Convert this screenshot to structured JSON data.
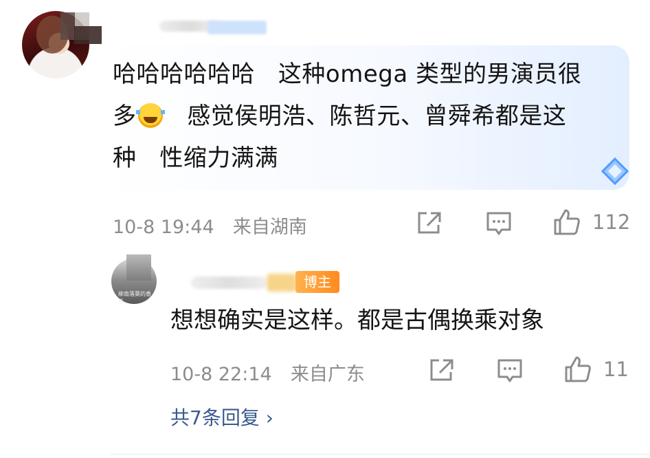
{
  "comment": {
    "text_line1": "哈哈哈哈哈哈   这种omega 类型的男演员很",
    "text_line2_prefix": "多",
    "text_line2_suffix": "   感觉侯明浩、陈哲元、曾舜希都是这",
    "text_line3": "种   性缩力满满",
    "time": "10-8 19:44",
    "location": "来自湖南",
    "like_count": "112"
  },
  "reply": {
    "badge": "博主",
    "text": "想想确实是这样。都是古偶换乘对象",
    "time": "10-8 22:14",
    "location": "来自广东",
    "like_count": "11",
    "avatar_caption": "柳南落葉的香香"
  },
  "more_replies": {
    "label": "共7条回复 ›"
  },
  "colors": {
    "meta_gray": "#8c8c8c",
    "link_blue": "#3a5a8c",
    "badge_orange": "#ff8a1f",
    "bubble_blue": "#e3eeff"
  },
  "icons": [
    "share-icon",
    "comment-icon",
    "like-icon",
    "laughing-emoji-icon",
    "diamond-badge-icon"
  ]
}
